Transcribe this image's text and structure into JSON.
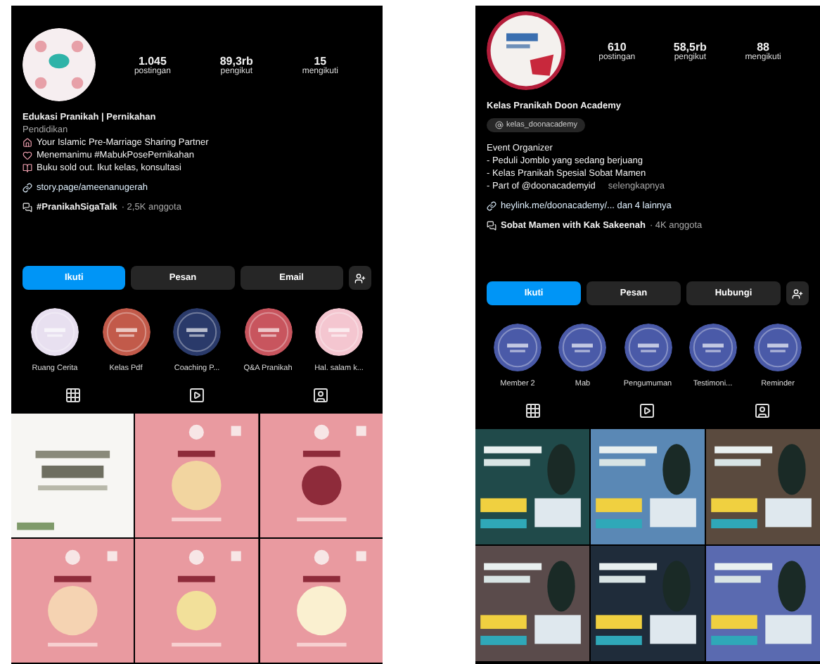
{
  "profiles": [
    {
      "stats": [
        {
          "value": "1.045",
          "label": "postingan"
        },
        {
          "value": "89,3rb",
          "label": "pengikut"
        },
        {
          "value": "15",
          "label": "mengikuti"
        }
      ],
      "name": "Edukasi Pranikah | Pernikahan",
      "category": "Pendidikan",
      "bio": [
        {
          "text": "Your Islamic Pre-Marriage Sharing Partner",
          "kind": "home"
        },
        {
          "text": "Menemanimu #MabukPosePernikahan",
          "kind": "heart"
        },
        {
          "text": "Buku sold out. Ikut kelas, konsultasi",
          "kind": "book"
        }
      ],
      "link": "story.page/ameenanugerah",
      "channel": {
        "name": "#PranikahSigaTalk",
        "members": "· 2,5K anggota"
      },
      "buttons": [
        {
          "label": "Ikuti",
          "kind": "primary"
        },
        {
          "label": "Pesan",
          "kind": "secondary"
        },
        {
          "label": "Email",
          "kind": "secondary"
        }
      ],
      "highlights": [
        {
          "label": "Ruang Cerita"
        },
        {
          "label": "Kelas Pdf"
        },
        {
          "label": "Coaching P..."
        },
        {
          "label": "Q&A Pranikah"
        },
        {
          "label": "Hal. salam k..."
        }
      ],
      "posts": [
        {
          "kind": "picture"
        },
        {
          "kind": "picture"
        },
        {
          "kind": "picture"
        },
        {
          "kind": "picture"
        },
        {
          "kind": "picture"
        },
        {
          "kind": "picture"
        }
      ]
    },
    {
      "stats": [
        {
          "value": "610",
          "label": "postingan"
        },
        {
          "value": "58,5rb",
          "label": "pengikut"
        },
        {
          "value": "88",
          "label": "mengikuti"
        }
      ],
      "name": "Kelas Pranikah Doon Academy",
      "threads": "kelas_doonacademy",
      "bio": [
        {
          "text": "Event Organizer"
        },
        {
          "text": "- Peduli Jomblo yang sedang berjuang"
        },
        {
          "text": "- Kelas Pranikah Spesial Sobat Mamen"
        },
        {
          "text": "- Part of @doonacademyid",
          "more": "selengkapnya"
        }
      ],
      "link": "heylink.me/doonacademy/... dan 4 lainnya",
      "channel": {
        "name": "Sobat Mamen with Kak Sakeenah",
        "members": "· 4K anggota"
      },
      "buttons": [
        {
          "label": "Ikuti",
          "kind": "primary"
        },
        {
          "label": "Pesan",
          "kind": "secondary"
        },
        {
          "label": "Hubungi",
          "kind": "secondary"
        }
      ],
      "highlights": [
        {
          "label": "Member 2"
        },
        {
          "label": "Mab"
        },
        {
          "label": "Pengumuman"
        },
        {
          "label": "Testimoni..."
        },
        {
          "label": "Reminder"
        }
      ],
      "posts": [
        {
          "kind": "picture"
        },
        {
          "kind": "picture"
        },
        {
          "kind": "picture"
        },
        {
          "kind": "picture"
        },
        {
          "kind": "picture"
        },
        {
          "kind": "picture"
        }
      ]
    }
  ]
}
